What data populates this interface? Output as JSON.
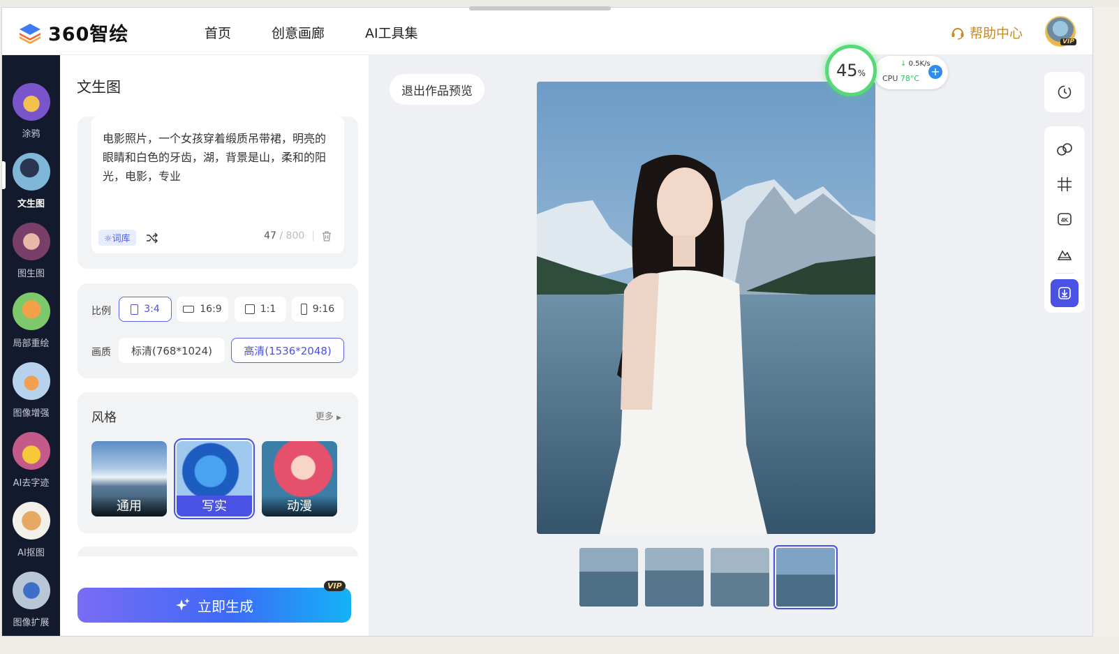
{
  "app": {
    "logo_text": "360智绘"
  },
  "nav": [
    "首页",
    "创意画廊",
    "AI工具集"
  ],
  "help": {
    "label": "帮助中心"
  },
  "user": {
    "vip_badge": "VIP"
  },
  "sidebar": {
    "items": [
      {
        "label": "涂鸦"
      },
      {
        "label": "文生图"
      },
      {
        "label": "图生图"
      },
      {
        "label": "局部重绘"
      },
      {
        "label": "图像增强"
      },
      {
        "label": "AI去字迹"
      },
      {
        "label": "AI抠图"
      },
      {
        "label": "图像扩展"
      }
    ],
    "active_index": 1
  },
  "panel": {
    "title": "文生图",
    "prompt": {
      "text": "电影照片，一个女孩穿着缎质吊带裙，明亮的眼睛和白色的牙齿，湖，背景是山，柔和的阳光，电影，专业",
      "ciku_label": "词库",
      "count": "47",
      "max": "/ 800"
    },
    "ratio": {
      "label": "比例",
      "options": [
        "3:4",
        "16:9",
        "1:1",
        "9:16"
      ],
      "selected": "3:4"
    },
    "quality": {
      "label": "画质",
      "options": [
        "标清(768*1024)",
        "高清(1536*2048)"
      ],
      "selected": "高清(1536*2048)"
    },
    "style": {
      "title": "风格",
      "more_label": "更多",
      "options": [
        "通用",
        "写实",
        "动漫"
      ],
      "selected": "写实"
    },
    "generate": {
      "label": "立即生成",
      "vip_badge": "VIP"
    }
  },
  "main": {
    "exit_preview_label": "退出作品预览",
    "thumbnail_count": 4,
    "selected_thumbnail": 4
  },
  "system_monitor": {
    "usage_value": "45",
    "usage_unit": "%",
    "net_speed": "0.5K/s",
    "cpu_label": "CPU",
    "cpu_temp": "78°C"
  },
  "colors": {
    "accent": "#4a52e6",
    "help": "#c58a25",
    "sidebar_bg": "#141a2e"
  }
}
